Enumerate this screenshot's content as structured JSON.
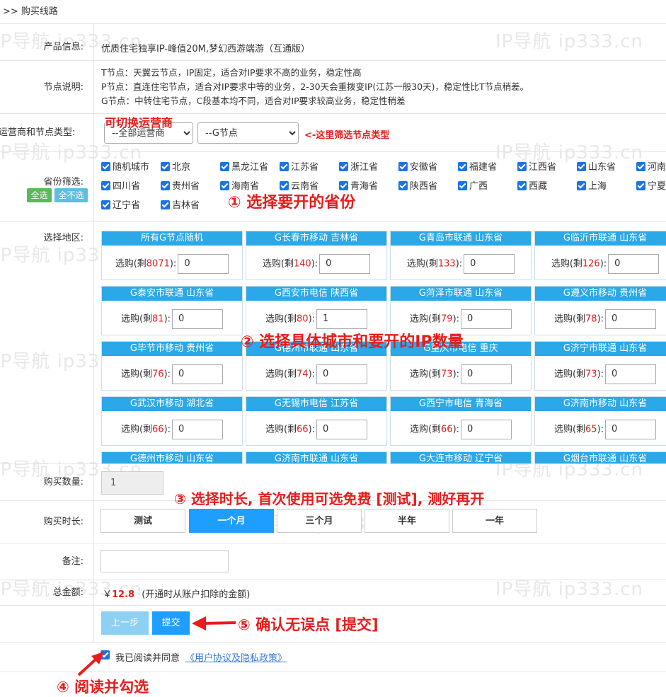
{
  "breadcrumb": ">> 购买线路",
  "watermark": "IP导航 ip333.cn",
  "product": {
    "label": "产品信息:",
    "value": "优质住宅独享IP-峰值20M,梦幻西游端游（互通版）"
  },
  "node_desc": {
    "label": "节点说明:",
    "lines": [
      "T节点：天翼云节点，IP固定，适合对IP要求不高的业务，稳定性高",
      "P节点：直连住宅节点，适合对IP要求中等的业务，2-30天会重拨变IP(江苏一般30天)，稳定性比T节点稍差。",
      "G节点：中转住宅节点，C段基本均不同，适合对IP要求较高业务，稳定性稍差"
    ]
  },
  "carrier": {
    "label": "运营商和节点类型:",
    "carrier_value": "--全部运营商",
    "node_value": "--G节点"
  },
  "province": {
    "label": "省份筛选:",
    "select_all": "全选",
    "select_none": "全不选",
    "items": [
      "随机城市",
      "北京",
      "黑龙江省",
      "江苏省",
      "浙江省",
      "安徽省",
      "福建省",
      "江西省",
      "山东省",
      "河南",
      "四川省",
      "贵州省",
      "海南省",
      "云南省",
      "青海省",
      "陕西省",
      "广西",
      "西藏",
      "上海",
      "宁夏",
      "辽宁省",
      "吉林省"
    ]
  },
  "region": {
    "label": "选择地区:",
    "buy_prefix": "选购(剩",
    "buy_suffix": "):",
    "cards": [
      {
        "title": "所有G节点随机",
        "remain": "8071",
        "qty": "0"
      },
      {
        "title": "G长春市移动 吉林省",
        "remain": "140",
        "qty": "0"
      },
      {
        "title": "G青岛市联通 山东省",
        "remain": "133",
        "qty": "0"
      },
      {
        "title": "G临沂市联通 山东省",
        "remain": "126",
        "qty": "0"
      },
      {
        "title": "G泰安市联通 山东省",
        "remain": "81",
        "qty": "0"
      },
      {
        "title": "G西安市电信 陕西省",
        "remain": "80",
        "qty": "1"
      },
      {
        "title": "G菏泽市联通 山东省",
        "remain": "79",
        "qty": "0"
      },
      {
        "title": "G遵义市移动 贵州省",
        "remain": "78",
        "qty": "0"
      },
      {
        "title": "G毕节市移动 贵州省",
        "remain": "76",
        "qty": "0"
      },
      {
        "title": "G德州市联通 山东省",
        "remain": "74",
        "qty": "0"
      },
      {
        "title": "G重庆市电信 重庆",
        "remain": "73",
        "qty": "0"
      },
      {
        "title": "G济宁市联通 山东省",
        "remain": "73",
        "qty": "0"
      },
      {
        "title": "G武汉市移动 湖北省",
        "remain": "66",
        "qty": "0"
      },
      {
        "title": "G无锡市电信 江苏省",
        "remain": "66",
        "qty": "0"
      },
      {
        "title": "G西宁市电信 青海省",
        "remain": "66",
        "qty": "0"
      },
      {
        "title": "G济南市移动 山东省",
        "remain": "65",
        "qty": "0"
      },
      {
        "title": "G德州市移动 山东省",
        "remain": "",
        "qty": ""
      },
      {
        "title": "G济南市联通 山东省",
        "remain": "",
        "qty": ""
      },
      {
        "title": "G大连市移动 辽宁省",
        "remain": "",
        "qty": ""
      },
      {
        "title": "G烟台市联通 山东省",
        "remain": "",
        "qty": ""
      }
    ]
  },
  "quantity": {
    "label": "购买数量:",
    "value": "1"
  },
  "duration": {
    "label": "购买时长:",
    "options": [
      "测试",
      "一个月",
      "三个月",
      "半年",
      "一年"
    ],
    "selected": "一个月"
  },
  "remark": {
    "label": "备注:",
    "value": ""
  },
  "total": {
    "label": "总金额:",
    "currency": "￥",
    "amount": "12.8",
    "note": "(开通时从账户扣除的金额)"
  },
  "buttons": {
    "prev": "上一步",
    "submit": "提交"
  },
  "agreement": {
    "text": "我已阅读并同意",
    "link": "《用户协议及隐私政策》",
    "checked": true
  },
  "annotations": {
    "carrier": "可切换运营商",
    "filter": "<-这里筛选节点类型",
    "step1": "① 选择要开的省份",
    "step2": "② 选择具体城市和要开的IP数量",
    "step3": "③ 选择时长, 首次使用可选免费 [测试], 测好再开",
    "step4": "④ 阅读并勾选",
    "step5": "⑤ 确认无误点 [提交]"
  },
  "colors": {
    "accent": "#1e9fff",
    "card_header": "#2aa8e8",
    "annotation": "#e81c1c",
    "remain": "#e02020",
    "select_all": "#5cb85c",
    "select_none": "#5bc0de",
    "prev_button": "#8ed0f3"
  }
}
